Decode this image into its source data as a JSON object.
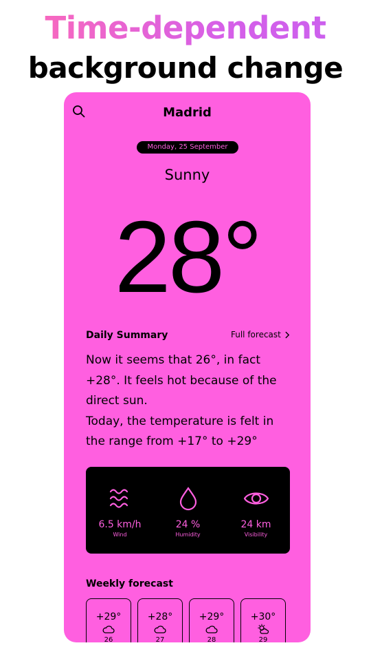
{
  "headline": {
    "line1": "Time-dependent",
    "line2": "background change"
  },
  "header": {
    "city": "Madrid",
    "search_icon": "search-icon"
  },
  "date": "Monday, 25 September",
  "condition": "Sunny",
  "temperature": "28°",
  "summary": {
    "title": "Daily Summary",
    "full_forecast_label": "Full forecast",
    "paragraphs": [
      "Now it seems that 26°, in fact +28°. It feels hot because of the direct sun.",
      "Today, the temperature is felt in the range from +17° to +29°"
    ]
  },
  "stats": [
    {
      "icon": "wind-icon",
      "value": "6.5 km/h",
      "label": "Wind"
    },
    {
      "icon": "humidity-drop-icon",
      "value": "24 %",
      "label": "Humidity"
    },
    {
      "icon": "visibility-eye-icon",
      "value": "24 km",
      "label": "Visibility"
    }
  ],
  "weekly": {
    "title": "Weekly forecast",
    "days": [
      {
        "temp": "+29°",
        "icon": "cloud-icon",
        "day": "26"
      },
      {
        "temp": "+28°",
        "icon": "cloud-icon",
        "day": "27"
      },
      {
        "temp": "+29°",
        "icon": "cloud-icon",
        "day": "28"
      },
      {
        "temp": "+30°",
        "icon": "sun-cloud-icon",
        "day": "29"
      }
    ]
  },
  "colors": {
    "background": "#ff5fe0",
    "dark": "#000000",
    "accent_text": "#ff5fe0"
  }
}
